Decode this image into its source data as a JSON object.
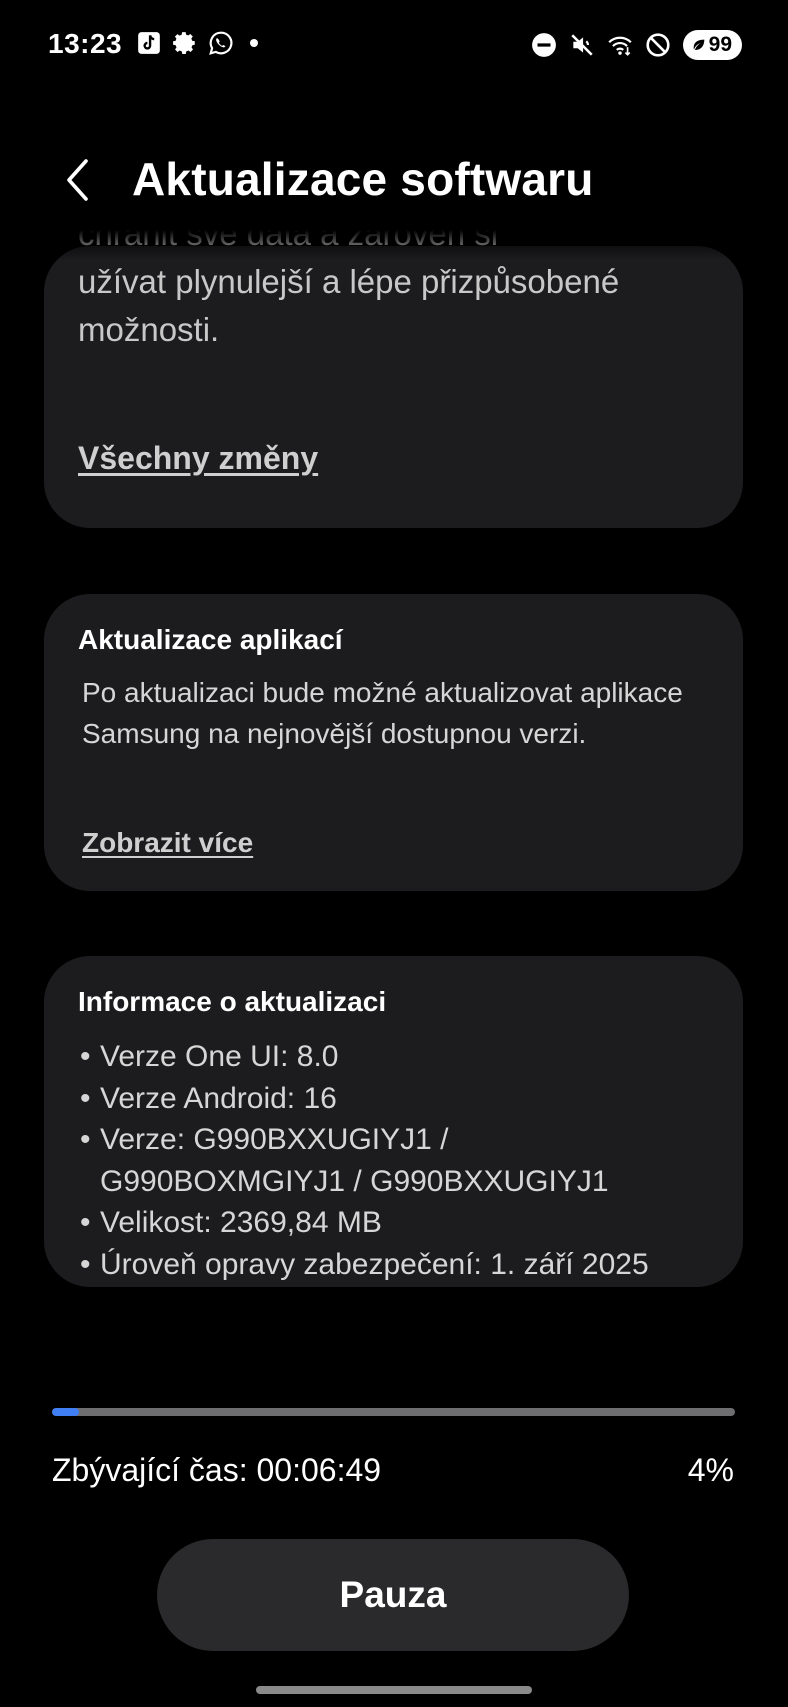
{
  "status_bar": {
    "time": "13:23",
    "left_icons": [
      "tiktok-icon",
      "gear-icon",
      "whatsapp-icon",
      "dot-icon"
    ],
    "right_icons": [
      "do-not-disturb-icon",
      "mute-icon",
      "wifi-icon",
      "blocked-icon"
    ],
    "battery": "99"
  },
  "header": {
    "title": "Aktualizace softwaru"
  },
  "card_changes": {
    "partial_top": "chránit své data a zároveň si",
    "text": "užívat plynulejší a lépe přizpůsobené možnosti.",
    "link": "Všechny změny"
  },
  "card_apps": {
    "title": "Aktualizace aplikací",
    "body": "Po aktualizaci bude možné aktualizovat aplikace Samsung na nejnovější dostupnou verzi.",
    "link": "Zobrazit více"
  },
  "card_info": {
    "title": "Informace o aktualizaci",
    "items": [
      "Verze One UI: 8.0",
      "Verze Android: 16",
      "Verze: G990BXXUGIYJ1 /\nG990BOXMGIYJ1 / G990BXXUGIYJ1",
      "Velikost: 2369,84 MB",
      "Úroveň opravy zabezpečení: 1. září 2025"
    ]
  },
  "progress": {
    "percent_value": 4,
    "percent_label": "4%",
    "remaining_label": "Zbývající čas:",
    "remaining_time": "00:06:49"
  },
  "actions": {
    "pause_label": "Pauza"
  },
  "colors": {
    "background": "#000000",
    "card": "#1c1c1e",
    "accent": "#3f7ef3",
    "track": "#6e6e70",
    "button": "#2a2a2c"
  }
}
